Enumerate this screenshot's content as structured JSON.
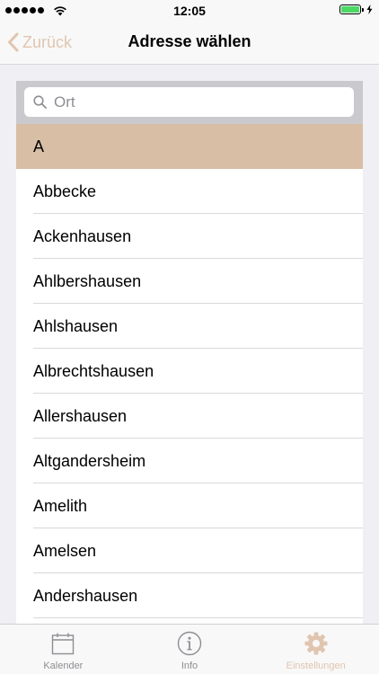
{
  "status_bar": {
    "time": "12:05",
    "battery_color": "#4cd964"
  },
  "nav": {
    "back_label": "Zurück",
    "title": "Adresse wählen"
  },
  "search": {
    "placeholder": "Ort",
    "value": ""
  },
  "section": {
    "header": "A"
  },
  "places": [
    "Abbecke",
    "Ackenhausen",
    "Ahlbershausen",
    "Ahlshausen",
    "Albrechtshausen",
    "Allershausen",
    "Altgandersheim",
    "Amelith",
    "Amelsen",
    "Andershausen"
  ],
  "tabs": [
    {
      "label": "Kalender",
      "icon": "calendar-icon"
    },
    {
      "label": "Info",
      "icon": "info-icon"
    },
    {
      "label": "Einstellungen",
      "icon": "gear-icon",
      "active": true
    }
  ],
  "colors": {
    "accent": "#e0c5b0",
    "section_header_bg": "#d8bea5",
    "search_area_bg": "#c9c9ce"
  }
}
